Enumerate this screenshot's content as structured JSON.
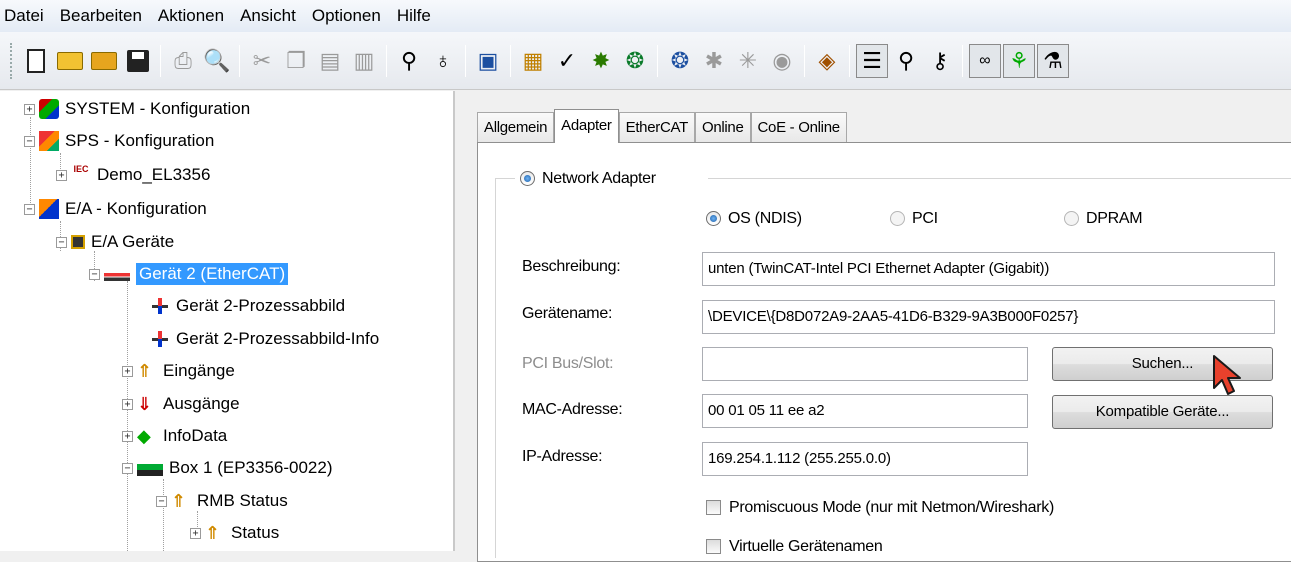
{
  "menu": [
    "Datei",
    "Bearbeiten",
    "Aktionen",
    "Ansicht",
    "Optionen",
    "Hilfe"
  ],
  "tree": {
    "items": [
      {
        "label": "SYSTEM - Konfiguration"
      },
      {
        "label": "SPS - Konfiguration"
      },
      {
        "label": "Demo_EL3356"
      },
      {
        "label": "E/A - Konfiguration"
      },
      {
        "label": "E/A Geräte"
      },
      {
        "label": "Gerät 2 (EtherCAT)"
      },
      {
        "label": "Gerät 2-Prozessabbild"
      },
      {
        "label": "Gerät 2-Prozessabbild-Info"
      },
      {
        "label": "Eingänge"
      },
      {
        "label": "Ausgänge"
      },
      {
        "label": "InfoData"
      },
      {
        "label": "Box 1 (EP3356-0022)"
      },
      {
        "label": "RMB Status"
      },
      {
        "label": "Status"
      }
    ],
    "iec_badge": "IEC"
  },
  "tabs": [
    "Allgemein",
    "Adapter",
    "EtherCAT",
    "Online",
    "CoE - Online"
  ],
  "adapter": {
    "network_adapter_label": "Network Adapter",
    "modes": [
      "OS (NDIS)",
      "PCI",
      "DPRAM"
    ],
    "beschreibung_label": "Beschreibung:",
    "beschreibung_value": "unten (TwinCAT-Intel PCI Ethernet Adapter (Gigabit))",
    "geraetename_label": "Gerätename:",
    "geraetename_value": "\\DEVICE\\{D8D072A9-2AA5-41D6-B329-9A3B000F0257}",
    "pci_label": "PCI Bus/Slot:",
    "pci_value": "",
    "suchen_button": "Suchen...",
    "mac_label": "MAC-Adresse:",
    "mac_value": "00 01 05 11 ee a2",
    "kompatible_button": "Kompatible Geräte...",
    "ip_label": "IP-Adresse:",
    "ip_value": "169.254.1.112 (255.255.0.0)",
    "promiscuous_label": "Promiscuous Mode (nur mit Netmon/Wireshark)",
    "virtuelle_label": "Virtuelle Gerätenamen"
  },
  "colors": {
    "selection": "#3399ff",
    "menubar": "#e4ebf5"
  }
}
